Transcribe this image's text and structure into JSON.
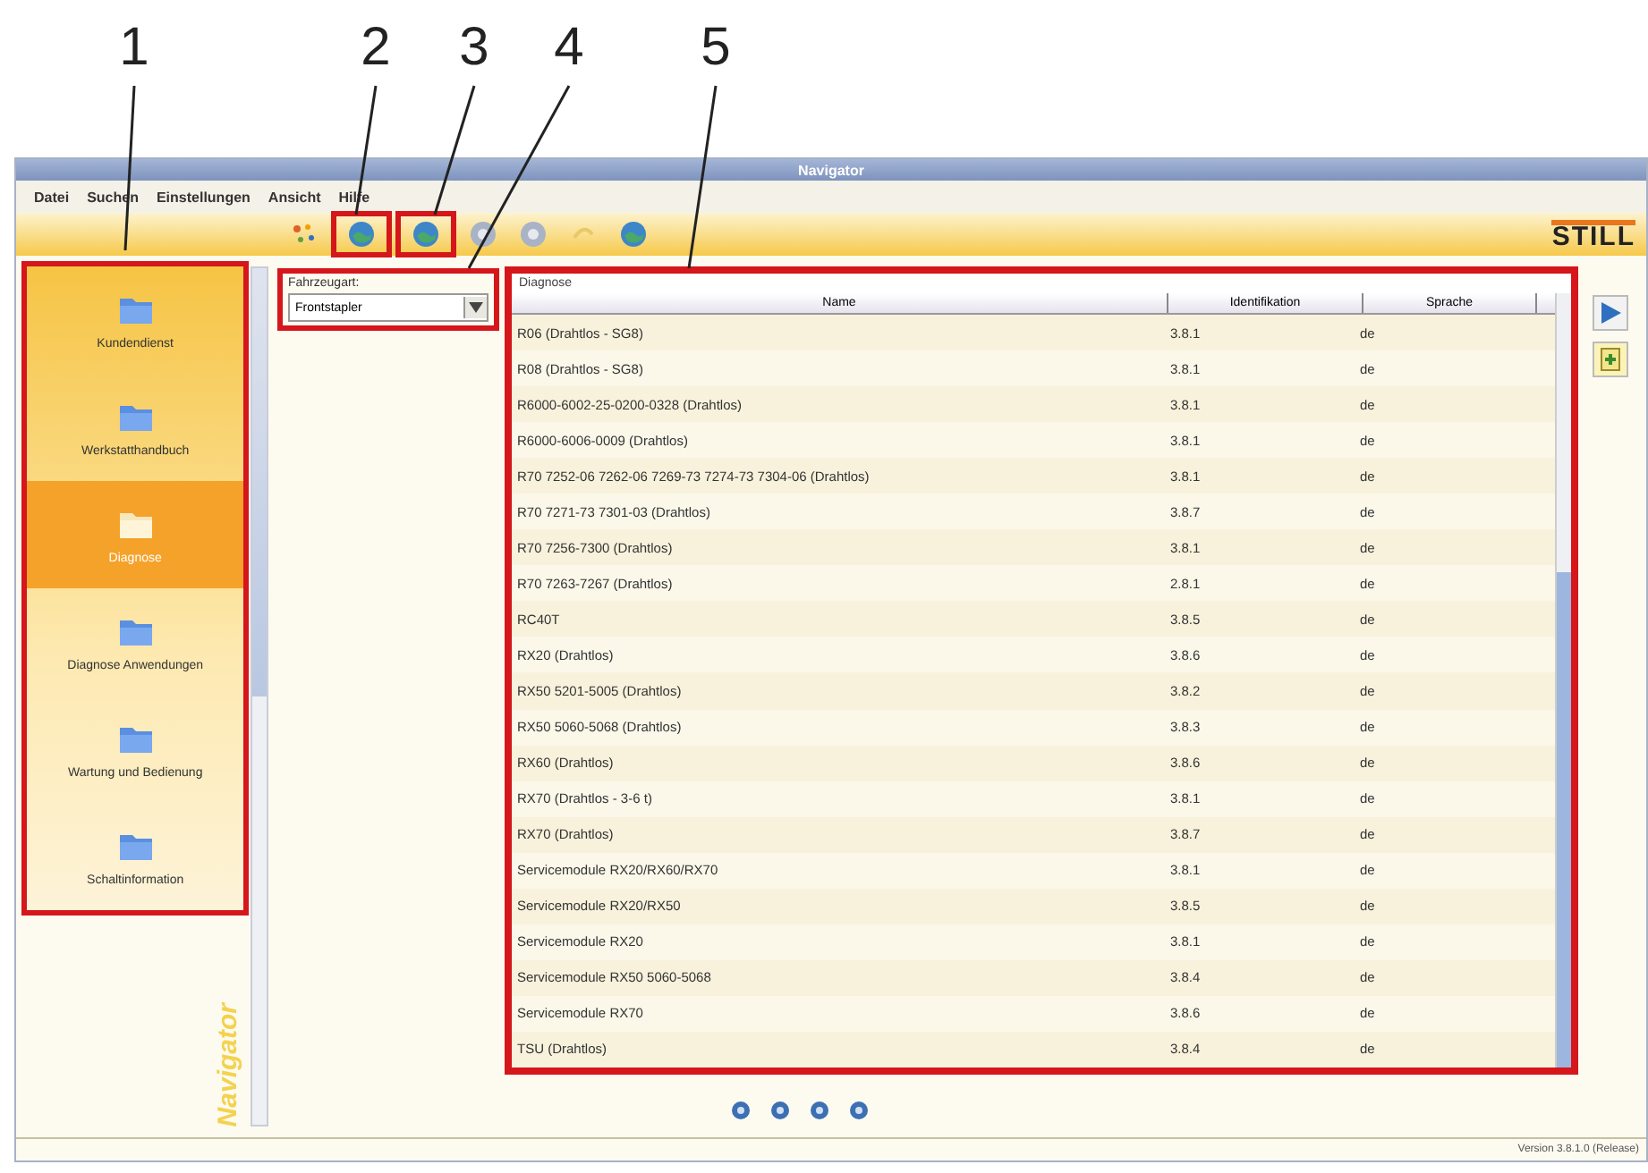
{
  "callouts": [
    {
      "label": "1"
    },
    {
      "label": "2"
    },
    {
      "label": "3"
    },
    {
      "label": "4"
    },
    {
      "label": "5"
    }
  ],
  "window": {
    "title": "Navigator"
  },
  "menu": [
    "Datei",
    "Suchen",
    "Einstellungen",
    "Ansicht",
    "Hilfe"
  ],
  "toolbar": [
    {
      "kind": "star",
      "highlighted": false
    },
    {
      "kind": "globe",
      "highlighted": true
    },
    {
      "kind": "globe",
      "highlighted": true
    },
    {
      "kind": "round",
      "highlighted": false
    },
    {
      "kind": "round",
      "highlighted": false
    },
    {
      "kind": "faint",
      "highlighted": false
    },
    {
      "kind": "globe",
      "highlighted": false
    }
  ],
  "logo": "STILL",
  "sidebar": {
    "highlighted": true,
    "side_label": "Navigator",
    "items": [
      {
        "label": "Kundendienst",
        "selected": false
      },
      {
        "label": "Werkstatthandbuch",
        "selected": false
      },
      {
        "label": "Diagnose",
        "selected": true
      },
      {
        "label": "Diagnose Anwendungen",
        "selected": false
      },
      {
        "label": "Wartung und Bedienung",
        "selected": false
      },
      {
        "label": "Schaltinformation",
        "selected": false
      }
    ]
  },
  "vehicle_type": {
    "highlighted": true,
    "label": "Fahrzeugart:",
    "value": "Frontstapler"
  },
  "table": {
    "highlighted": true,
    "title": "Diagnose",
    "columns": [
      "Name",
      "Identifikation",
      "Sprache"
    ],
    "rows": [
      [
        "R06 (Drahtlos - SG8)",
        "3.8.1",
        "de"
      ],
      [
        "R08 (Drahtlos - SG8)",
        "3.8.1",
        "de"
      ],
      [
        "R6000-6002-25-0200-0328 (Drahtlos)",
        "3.8.1",
        "de"
      ],
      [
        "R6000-6006-0009 (Drahtlos)",
        "3.8.1",
        "de"
      ],
      [
        "R70 7252-06 7262-06 7269-73 7274-73 7304-06 (Drahtlos)",
        "3.8.1",
        "de"
      ],
      [
        "R70 7271-73 7301-03 (Drahtlos)",
        "3.8.7",
        "de"
      ],
      [
        "R70 7256-7300 (Drahtlos)",
        "3.8.1",
        "de"
      ],
      [
        "R70 7263-7267 (Drahtlos)",
        "2.8.1",
        "de"
      ],
      [
        "RC40T",
        "3.8.5",
        "de"
      ],
      [
        "RX20 (Drahtlos)",
        "3.8.6",
        "de"
      ],
      [
        "RX50 5201-5005 (Drahtlos)",
        "3.8.2",
        "de"
      ],
      [
        "RX50 5060-5068 (Drahtlos)",
        "3.8.3",
        "de"
      ],
      [
        "RX60 (Drahtlos)",
        "3.8.6",
        "de"
      ],
      [
        "RX70 (Drahtlos - 3-6 t)",
        "3.8.1",
        "de"
      ],
      [
        "RX70 (Drahtlos)",
        "3.8.7",
        "de"
      ],
      [
        "Servicemodule RX20/RX60/RX70",
        "3.8.1",
        "de"
      ],
      [
        "Servicemodule RX20/RX50",
        "3.8.5",
        "de"
      ],
      [
        "Servicemodule RX20",
        "3.8.1",
        "de"
      ],
      [
        "Servicemodule RX50 5060-5068",
        "3.8.4",
        "de"
      ],
      [
        "Servicemodule RX70",
        "3.8.6",
        "de"
      ],
      [
        "TSU (Drahtlos)",
        "3.8.4",
        "de"
      ]
    ]
  },
  "status_bar": "Version 3.8.1.0 (Release)"
}
